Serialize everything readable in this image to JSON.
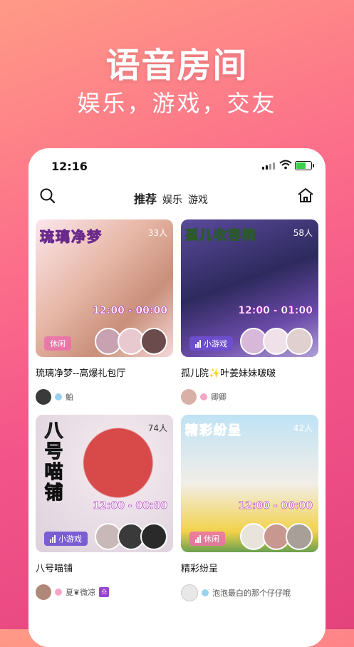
{
  "promo": {
    "headline": "语音房间",
    "subline": "娱乐，游戏，交友"
  },
  "status_bar": {
    "time": "12:16"
  },
  "nav": {
    "tabs": [
      "推荐",
      "娱乐",
      "游戏"
    ],
    "active_tab": "推荐",
    "left_icon": "search-icon",
    "right_icon": "home-icon"
  },
  "rooms": [
    {
      "thumb_title": "琉璃净梦",
      "count": "33人",
      "time_slot": "12:00 - 00:00",
      "badge": "休闲",
      "badge_type": "leisure",
      "title": "琉璃净梦--高爆礼包厅",
      "owner": "鲌",
      "accent": "#f0b6c4"
    },
    {
      "thumb_title": "孤儿收容院",
      "count": "58人",
      "time_slot": "12:00 - 01:00",
      "badge": "小游戏",
      "badge_type": "game",
      "title": "孤儿院✨叶姜妹妹啵啵",
      "owner": "卿卿",
      "accent": "#3b2f6b"
    },
    {
      "thumb_title": "八号喵铺",
      "count": "74人",
      "time_slot": "12:00 - 00:00",
      "badge": "小游戏",
      "badge_type": "game",
      "title": "八号喵铺",
      "owner": "夏❦微凉",
      "owner_zodiac": "♎",
      "accent": "#d8c8d8"
    },
    {
      "thumb_title": "精彩纷呈",
      "count": "42人",
      "time_slot": "12:00 - 00:00",
      "badge": "休闲",
      "badge_type": "leisure",
      "title": "精彩纷呈",
      "owner": "泡泡最白的那个仔仔哦",
      "accent": "#bfe3f5"
    }
  ]
}
